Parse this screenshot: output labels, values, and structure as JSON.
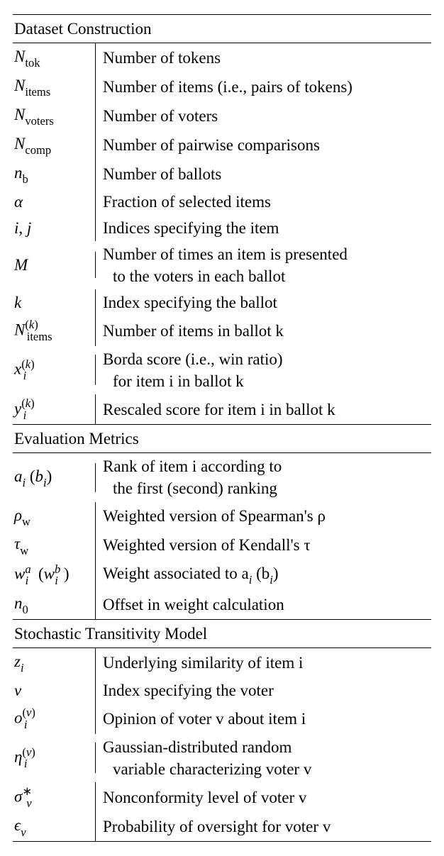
{
  "sections": [
    {
      "title": "Dataset Construction",
      "rows": [
        {
          "symbol_html": "<span class='it'>N</span><span class='sub'>tok</span>",
          "desc": "Number of tokens"
        },
        {
          "symbol_html": "<span class='it'>N</span><span class='sub'>items</span>",
          "desc": "Number of items (i.e., pairs of tokens)"
        },
        {
          "symbol_html": "<span class='it'>N</span><span class='sub'>voters</span>",
          "desc": "Number of voters"
        },
        {
          "symbol_html": "<span class='it'>N</span><span class='sub'>comp</span>",
          "desc": "Number of pairwise comparisons"
        },
        {
          "symbol_html": "<span class='it'>n</span><span class='sub'>b</span>",
          "desc": "Number of ballots"
        },
        {
          "symbol_html": "<span class='it'>α</span>",
          "desc": "Fraction of selected items"
        },
        {
          "symbol_html": "<span class='it'>i</span>, <span class='it'>j</span>",
          "desc": "Indices specifying the item"
        },
        {
          "symbol_html": "<span class='it'>M</span>",
          "desc": "Number of times an item is presented",
          "desc2": "to the voters in each ballot"
        },
        {
          "symbol_html": "<span class='it'>k</span>",
          "desc": "Index specifying the ballot"
        },
        {
          "symbol_html": "<span class='it'>N</span><span class='sup'>(<span class='it'>k</span>)</span><span class='sub' style='position:relative;left:-16px;'>items</span>",
          "desc": "Number of items in ballot <span class='it'>k</span>",
          "raw": true
        },
        {
          "symbol_html": "<span class='it'>x</span><span class='sup'>(<span class='it'>k</span>)</span><span class='subit' style='position:relative;left:-16px;'>i</span>",
          "desc": "Borda score (i.e., win ratio)",
          "desc2": "for item <span class='it'>i</span> in ballot <span class='it'>k</span>",
          "raw": true
        },
        {
          "symbol_html": "<span class='it'>y</span><span class='sup'>(<span class='it'>k</span>)</span><span class='subit' style='position:relative;left:-16px;'>i</span>",
          "desc": "Rescaled score for item <span class='it'>i</span> in ballot <span class='it'>k</span>",
          "raw": true
        }
      ]
    },
    {
      "title": "Evaluation Metrics",
      "rows": [
        {
          "symbol_html": "<span class='it'>a</span><span class='subit'>i</span> (<span class='it'>b</span><span class='subit'>i</span>)",
          "desc": "Rank of item <span class='it'>i</span> according to",
          "desc2": "the first (second) ranking",
          "raw": true
        },
        {
          "symbol_html": "<span class='it'>ρ</span><span class='sub'>w</span>",
          "desc": "Weighted version of Spearman's <span class='it'>ρ</span>",
          "raw": true
        },
        {
          "symbol_html": "<span class='it'>τ</span><span class='sub'>w</span>",
          "desc": "Weighted version of Kendall's <span class='it'>τ</span>",
          "raw": true
        },
        {
          "symbol_html": "<span class='it'>w</span><span class='supit'>a</span><span class='subit' style='position:relative;left:-8px;'>i</span> (<span class='it'>w</span><span class='supit'>b</span><span class='subit' style='position:relative;left:-8px;'>i</span>)",
          "desc": "Weight associated to <span class='it'>a</span><span class='subit'>i</span> (<span class='it'>b</span><span class='subit'>i</span>)",
          "raw": true
        },
        {
          "symbol_html": "<span class='it'>n</span><span class='sub'>0</span>",
          "desc": "Offset in weight calculation"
        }
      ]
    },
    {
      "title": "Stochastic Transitivity Model",
      "rows": [
        {
          "symbol_html": "<span class='it'>z</span><span class='subit'>i</span>",
          "desc": "Underlying similarity of item <span class='it'>i</span>",
          "raw": true
        },
        {
          "symbol_html": "<span class='it'>v</span>",
          "desc": "Index specifying the voter"
        },
        {
          "symbol_html": "<span class='it'>o</span><span class='sup'>(<span class='it'>v</span>)</span><span class='subit' style='position:relative;left:-16px;'>i</span>",
          "desc": "Opinion of voter <span class='it'>v</span> about item <span class='it'>i</span>",
          "raw": true
        },
        {
          "symbol_html": "<span class='it'>η</span><span class='sup'>(<span class='it'>v</span>)</span><span class='subit' style='position:relative;left:-16px;'>i</span>",
          "desc": "Gaussian-distributed random",
          "desc2": "variable characterizing voter <span class='it'>v</span>",
          "raw": true
        },
        {
          "symbol_html": "<span class='it'>σ</span><span class='sup'>∗</span><span class='subit' style='position:relative;left:-8px;'>v</span>",
          "desc": "Nonconformity level of voter <span class='it'>v</span>",
          "raw": true
        },
        {
          "symbol_html": "<span class='it'>ϵ</span><span class='subit'>v</span>",
          "desc": "Probability of oversight for voter <span class='it'>v</span>",
          "raw": true
        }
      ]
    }
  ]
}
